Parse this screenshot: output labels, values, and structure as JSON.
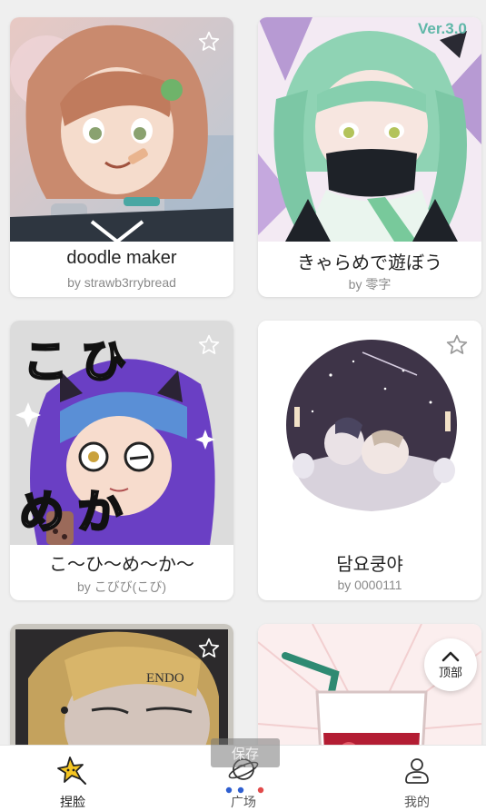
{
  "gallery": {
    "cards": [
      {
        "title": "doodle maker",
        "author": "by strawb3rrybread",
        "art_icon": "girl-with-phone-portrait"
      },
      {
        "title": "きゃらめで遊ぼう",
        "author": "by 零字",
        "art_icon": "green-hair-girl-mask-portrait",
        "corner_text": "Ver.3.0"
      },
      {
        "title": "こ～ひ～め～か～",
        "author": "by こびび(こび)",
        "art_icon": "purple-hair-glasses-girl-portrait",
        "overlay_text_top": "こ  ひ",
        "overlay_text_bottom": "め か"
      },
      {
        "title": "담요쿵야",
        "author": "by 0000111",
        "art_icon": "sleeping-characters-circle-illustration"
      },
      {
        "title": "",
        "author": "",
        "art_icon": "blonde-boy-portrait",
        "art_text": "ENDO"
      },
      {
        "title": "",
        "author": "",
        "art_icon": "drink-glass-illustration"
      }
    ]
  },
  "top_button": {
    "label": "顶部",
    "icon": "chevron-up-icon"
  },
  "save_tip": {
    "label": "保存"
  },
  "bottom_nav": {
    "items": [
      {
        "label": "捏脸",
        "icon": "star-face-icon",
        "active": true
      },
      {
        "label": "广场",
        "icon": "planet-icon",
        "active": false
      },
      {
        "label": "我的",
        "icon": "user-icon",
        "active": false
      }
    ]
  },
  "colors": {
    "accent": "#f5c623",
    "background": "#efefef",
    "dot_blue": "#2f5fd0",
    "dot_red": "#e24a4a"
  }
}
